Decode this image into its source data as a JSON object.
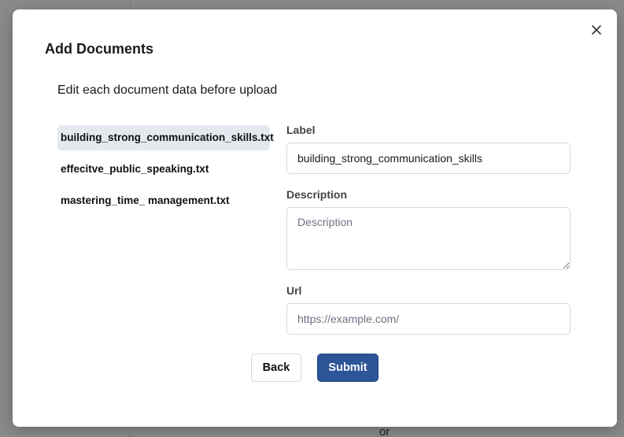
{
  "backdrop": {
    "bottom_text": "or"
  },
  "modal": {
    "title": "Add Documents",
    "subtitle": "Edit each document data before upload",
    "close_icon": "close-icon"
  },
  "documents": [
    {
      "name": "building_strong_communication_skills.txt",
      "selected": true
    },
    {
      "name": "effecitve_public_speaking.txt",
      "selected": false
    },
    {
      "name": "mastering_time_ management.txt",
      "selected": false
    }
  ],
  "form": {
    "label": {
      "title": "Label",
      "value": "building_strong_communication_skills"
    },
    "description": {
      "title": "Description",
      "placeholder": "Description",
      "value": ""
    },
    "url": {
      "title": "Url",
      "placeholder": "https://example.com/",
      "value": ""
    }
  },
  "actions": {
    "back_label": "Back",
    "submit_label": "Submit"
  },
  "colors": {
    "primary": "#2b5597",
    "selected_bg": "#e4e8ef"
  }
}
